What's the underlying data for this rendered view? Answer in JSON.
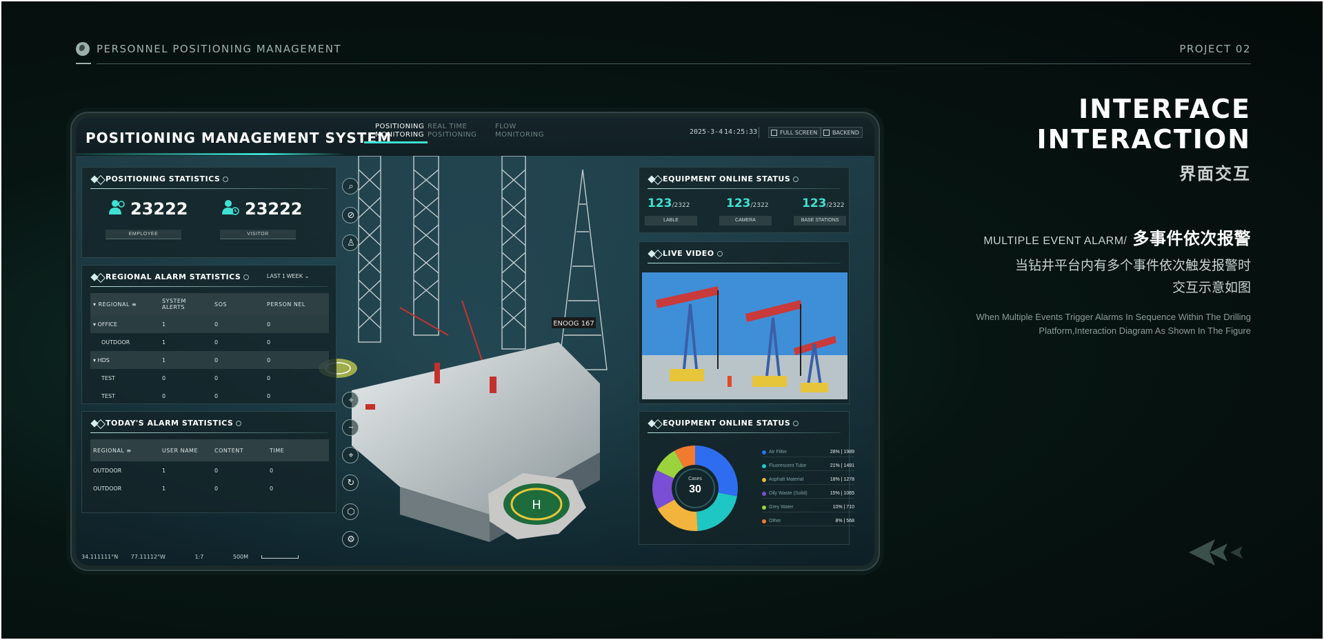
{
  "page": {
    "header_title": "PERSONNEL POSITIONING MANAGEMENT",
    "project_label": "PROJECT 02"
  },
  "intro": {
    "title_line1": "INTERFACE",
    "title_line2": "INTERACTION",
    "title_cn": "界面交互",
    "alarm_en": "MULTIPLE EVENT ALARM/",
    "alarm_cn": "多事件依次报警",
    "desc_cn_line1": "当钻井平台内有多个事件依次触发报警时",
    "desc_cn_line2": "交互示意如图",
    "desc_en_line1": "When Multiple Events Trigger Alarms In Sequence Within The Drilling",
    "desc_en_line2": "Platform,Interaction Diagram As Shown In The Figure"
  },
  "dashboard": {
    "system_title": "POSITIONING MANAGEMENT SYSTEM",
    "tabs": [
      {
        "line1": "POSITIONING",
        "line2": "MONITORING"
      },
      {
        "line1": "REAL TIME",
        "line2": "POSITIONING"
      },
      {
        "line1": "FLOW",
        "line2": "MONITORING"
      }
    ],
    "date": "2025-3-4",
    "time": "14:25:33",
    "full_screen_label": "FULL SCREEN",
    "backend_label": "BACKEND",
    "positioning_stats": {
      "title": "POSITIONING STATISTICS",
      "employee_count": "23222",
      "employee_label": "EMPLOYEE",
      "visitor_count": "23222",
      "visitor_label": "VISITOR"
    },
    "regional_alarm": {
      "title": "REGIONAL ALARM STATISTICS",
      "period": "LAST 1 WEEK",
      "headers": [
        "REGIONAL",
        "SYSTEM ALERTS",
        "SOS",
        "PERSON NEL"
      ],
      "rows": [
        {
          "name": "OFFICE",
          "v1": "1",
          "v2": "0",
          "v3": "0"
        },
        {
          "name": "OUTDOOR",
          "v1": "1",
          "v2": "0",
          "v3": "0"
        },
        {
          "name": "HDS",
          "v1": "1",
          "v2": "0",
          "v3": "0"
        },
        {
          "name": "TEST",
          "v1": "0",
          "v2": "0",
          "v3": "0"
        },
        {
          "name": "TEST",
          "v1": "0",
          "v2": "0",
          "v3": "0"
        }
      ]
    },
    "today_alarm": {
      "title": "TODAY'S ALARM STATISTICS",
      "headers": [
        "REGIONAL",
        "USER NAME",
        "CONTENT",
        "TIME"
      ],
      "rows": [
        {
          "name": "OUTDOOR",
          "v1": "1",
          "v2": "0",
          "v3": "0"
        },
        {
          "name": "OUTDOOR",
          "v1": "1",
          "v2": "0",
          "v3": "0"
        }
      ]
    },
    "equipment": {
      "title": "EQUIPMENT ONLINE STATUS",
      "items": [
        {
          "value": "123",
          "total": "/2322",
          "label": "LABLE"
        },
        {
          "value": "123",
          "total": "/2322",
          "label": "CAMERA"
        },
        {
          "value": "123",
          "total": "/2322",
          "label": "BASE STATIONS"
        }
      ]
    },
    "live_video": {
      "title": "LIVE VIDEO"
    },
    "equipment2": {
      "title": "EQUIPMENT ONLINE STATUS",
      "center_label": "Cases",
      "center_value": "30",
      "legend": [
        {
          "name": "Air Filter",
          "value": "28% | 1989",
          "color": "#2f6df0"
        },
        {
          "name": "Fluorescent Tube",
          "value": "21% | 1491",
          "color": "#1fc7c4"
        },
        {
          "name": "Asphalt Material",
          "value": "18% | 1278",
          "color": "#f2b43c"
        },
        {
          "name": "Oily Waste (Solid)",
          "value": "15% | 1065",
          "color": "#7a4fd6"
        },
        {
          "name": "Grey Water",
          "value": "10% | 710",
          "color": "#9bd33f"
        },
        {
          "name": "Other",
          "value": "8% | 568",
          "color": "#f07a2e"
        }
      ]
    },
    "footer": {
      "lat": "34.111111°N",
      "lng": "77.11112°W",
      "scale": "1:7",
      "distance": "500M"
    }
  },
  "chart_data": {
    "type": "pie",
    "title": "EQUIPMENT ONLINE STATUS",
    "categories": [
      "Air Filter",
      "Fluorescent Tube",
      "Asphalt Material",
      "Oily Waste (Solid)",
      "Grey Water",
      "Other"
    ],
    "values": [
      28,
      21,
      18,
      15,
      10,
      8
    ],
    "counts": [
      1989,
      1491,
      1278,
      1065,
      710,
      568
    ],
    "colors": [
      "#2f6df0",
      "#1fc7c4",
      "#f2b43c",
      "#7a4fd6",
      "#9bd33f",
      "#f07a2e"
    ]
  }
}
